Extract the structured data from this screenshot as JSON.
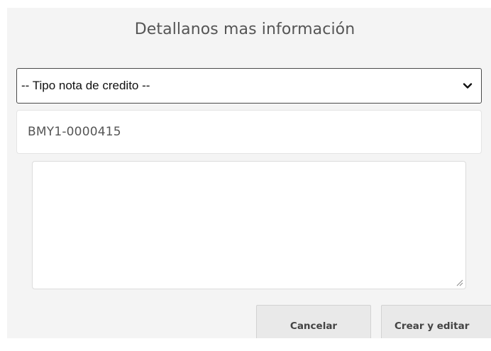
{
  "dialog": {
    "title": "Detallanos mas información",
    "credit_note_type": {
      "selected": "-- Tipo nota de credito --",
      "icon": "chevron-down-icon"
    },
    "invoice_field": {
      "value": "BMY1-0000415"
    },
    "notes_field": {
      "value": ""
    },
    "buttons": {
      "cancel_label": "Cancelar",
      "create_label": "Crear y editar"
    }
  },
  "colors": {
    "panel_background": "#f4f4f4",
    "title_text": "#555555",
    "button_background": "#e9e9e9",
    "button_text": "#444444"
  }
}
